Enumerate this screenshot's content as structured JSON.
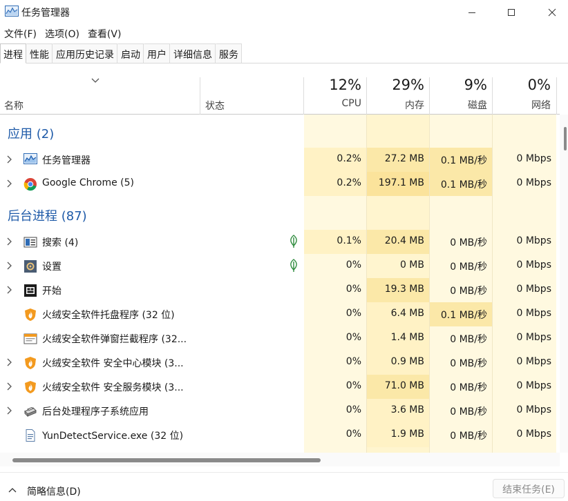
{
  "window": {
    "title": "任务管理器",
    "icon": "task-manager-icon",
    "controls": [
      "minimize-icon",
      "maximize-icon",
      "close-icon"
    ]
  },
  "menu": [
    "文件(F)",
    "选项(O)",
    "查看(V)"
  ],
  "tabs": [
    "进程",
    "性能",
    "应用历史记录",
    "启动",
    "用户",
    "详细信息",
    "服务"
  ],
  "active_tab": "进程",
  "columns": {
    "name": "名称",
    "status": "状态",
    "cpu": {
      "percent": "12%",
      "label": "CPU"
    },
    "memory": {
      "percent": "29%",
      "label": "内存"
    },
    "disk": {
      "percent": "9%",
      "label": "磁盘"
    },
    "network": {
      "percent": "0%",
      "label": "网络"
    }
  },
  "groups": {
    "apps": "应用 (2)",
    "background": "后台进程 (87)"
  },
  "rows": [
    {
      "name": "任务管理器",
      "icon": "task-manager-icon",
      "expandable": true,
      "cpu": "0.2%",
      "mem": "27.2 MB",
      "disk": "0.1 MB/秒",
      "net": "0 Mbps",
      "leaf": false
    },
    {
      "name": "Google Chrome (5)",
      "icon": "chrome-icon",
      "expandable": true,
      "cpu": "0.2%",
      "mem": "197.1 MB",
      "disk": "0.1 MB/秒",
      "net": "0 Mbps",
      "leaf": false
    },
    {
      "name": "搜索 (4)",
      "icon": "search-app-icon",
      "expandable": true,
      "cpu": "0.1%",
      "mem": "20.4 MB",
      "disk": "0 MB/秒",
      "net": "0 Mbps",
      "leaf": true
    },
    {
      "name": "设置",
      "icon": "settings-gear-icon",
      "expandable": true,
      "cpu": "0%",
      "mem": "0 MB",
      "disk": "0 MB/秒",
      "net": "0 Mbps",
      "leaf": true
    },
    {
      "name": "开始",
      "icon": "start-icon",
      "expandable": true,
      "cpu": "0%",
      "mem": "19.3 MB",
      "disk": "0 MB/秒",
      "net": "0 Mbps",
      "leaf": false
    },
    {
      "name": "火绒安全软件托盘程序 (32 位)",
      "icon": "huorong-shield-icon",
      "expandable": false,
      "cpu": "0%",
      "mem": "6.4 MB",
      "disk": "0.1 MB/秒",
      "net": "0 Mbps",
      "leaf": false
    },
    {
      "name": "火绒安全软件弹窗拦截程序 (32...",
      "icon": "popup-blocker-icon",
      "expandable": false,
      "cpu": "0%",
      "mem": "1.4 MB",
      "disk": "0 MB/秒",
      "net": "0 Mbps",
      "leaf": false
    },
    {
      "name": "火绒安全软件 安全中心模块 (3...",
      "icon": "huorong-shield-icon",
      "expandable": true,
      "cpu": "0%",
      "mem": "0.9 MB",
      "disk": "0 MB/秒",
      "net": "0 Mbps",
      "leaf": false
    },
    {
      "name": "火绒安全软件 安全服务模块 (3...",
      "icon": "huorong-shield-icon",
      "expandable": true,
      "cpu": "0%",
      "mem": "71.0 MB",
      "disk": "0 MB/秒",
      "net": "0 Mbps",
      "leaf": false
    },
    {
      "name": "后台处理程序子系统应用",
      "icon": "printer-icon",
      "expandable": true,
      "cpu": "0%",
      "mem": "3.6 MB",
      "disk": "0 MB/秒",
      "net": "0 Mbps",
      "leaf": false
    },
    {
      "name": "YunDetectService.exe (32 位)",
      "icon": "document-icon",
      "expandable": false,
      "cpu": "0%",
      "mem": "1.9 MB",
      "disk": "0 MB/秒",
      "net": "0 Mbps",
      "leaf": false
    }
  ],
  "footer": {
    "fewer_details": "简略信息(D)",
    "end_task": "结束任务(E)"
  },
  "colors": {
    "group_heading": "#1e5aa8",
    "heat_light": "#fff9e0",
    "heat_medium": "#fff2c5",
    "heat_strong": "#fbe8a8",
    "eco_leaf": "#2e8b3d"
  }
}
